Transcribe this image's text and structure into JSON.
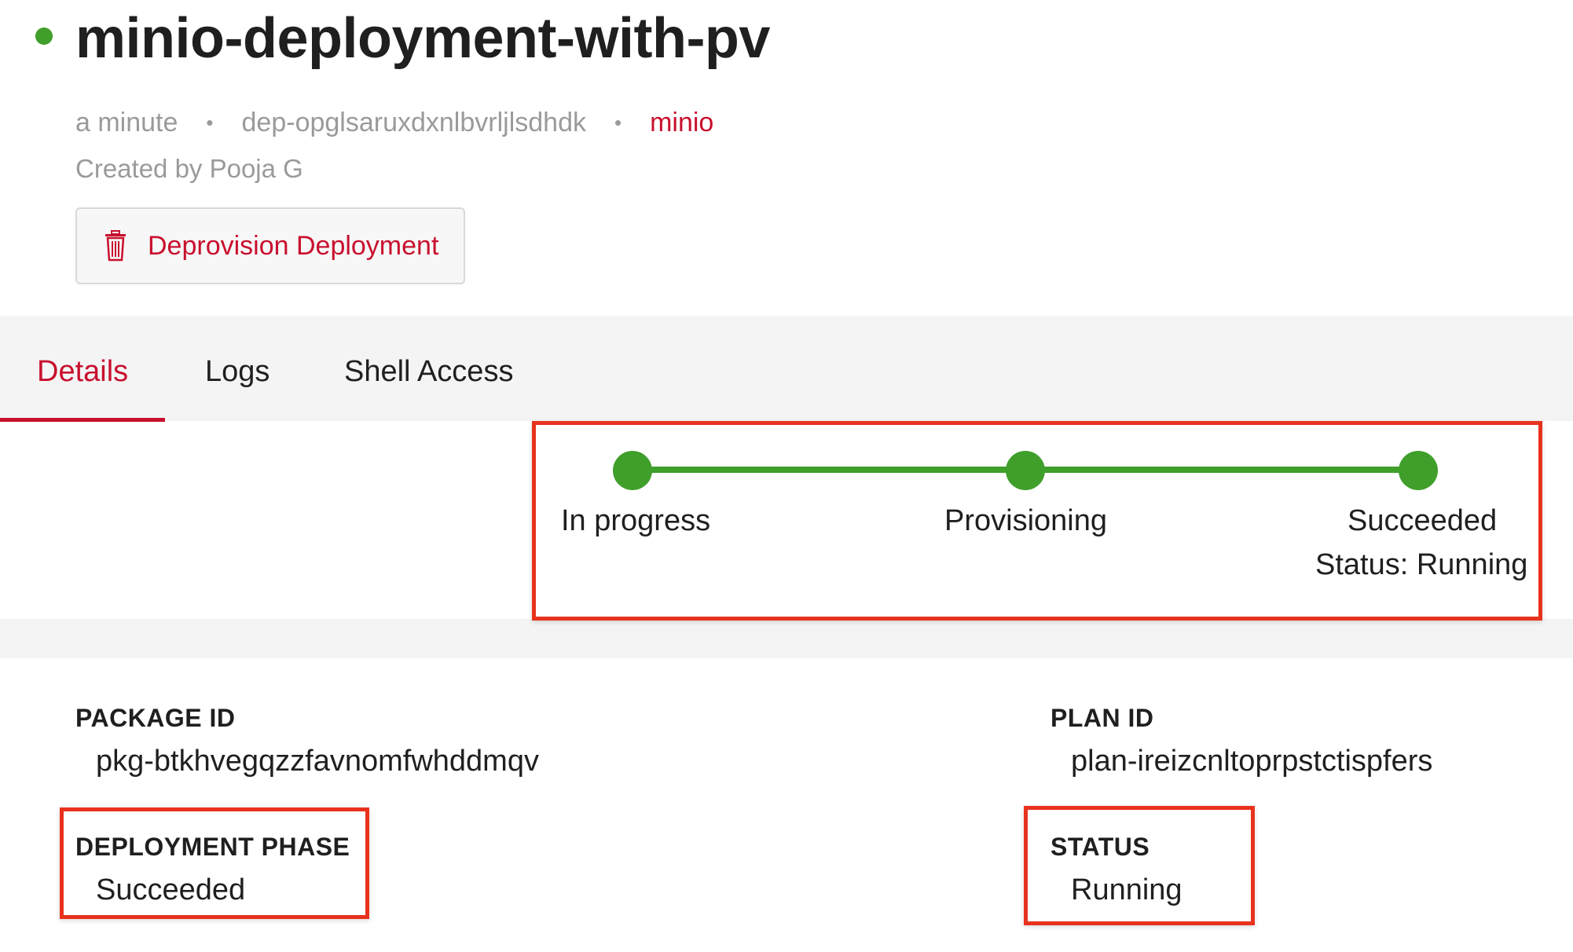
{
  "header": {
    "title": "minio-deployment-with-pv",
    "status_color": "#3f9f2a",
    "age": "a minute",
    "deployment_id": "dep-opglsaruxdxnlbvrljlsdhdk",
    "package_link": "minio",
    "separator": "•",
    "created_by": "Created by Pooja G"
  },
  "actions": {
    "deprovision_label": "Deprovision Deployment",
    "deprovision_icon": "trash-icon"
  },
  "tabs": [
    {
      "label": "Details",
      "active": true
    },
    {
      "label": "Logs",
      "active": false
    },
    {
      "label": "Shell Access",
      "active": false
    }
  ],
  "progress": {
    "steps": [
      {
        "label": "In progress",
        "complete": true
      },
      {
        "label": "Provisioning",
        "complete": true
      },
      {
        "label": "Succeeded",
        "complete": true
      }
    ],
    "status_text": "Status: Running",
    "color": "#3f9f2a"
  },
  "details": {
    "package_id": {
      "label": "PACKAGE ID",
      "value": "pkg-btkhvegqzzfavnomfwhddmqv"
    },
    "plan_id": {
      "label": "PLAN ID",
      "value": "plan-ireizcnltoprpstctispfers"
    },
    "deployment_phase": {
      "label": "DEPLOYMENT PHASE",
      "value": "Succeeded"
    },
    "status": {
      "label": "STATUS",
      "value": "Running"
    }
  },
  "colors": {
    "accent": "#c8102e",
    "highlight": "#e8321e",
    "success": "#3f9f2a"
  }
}
